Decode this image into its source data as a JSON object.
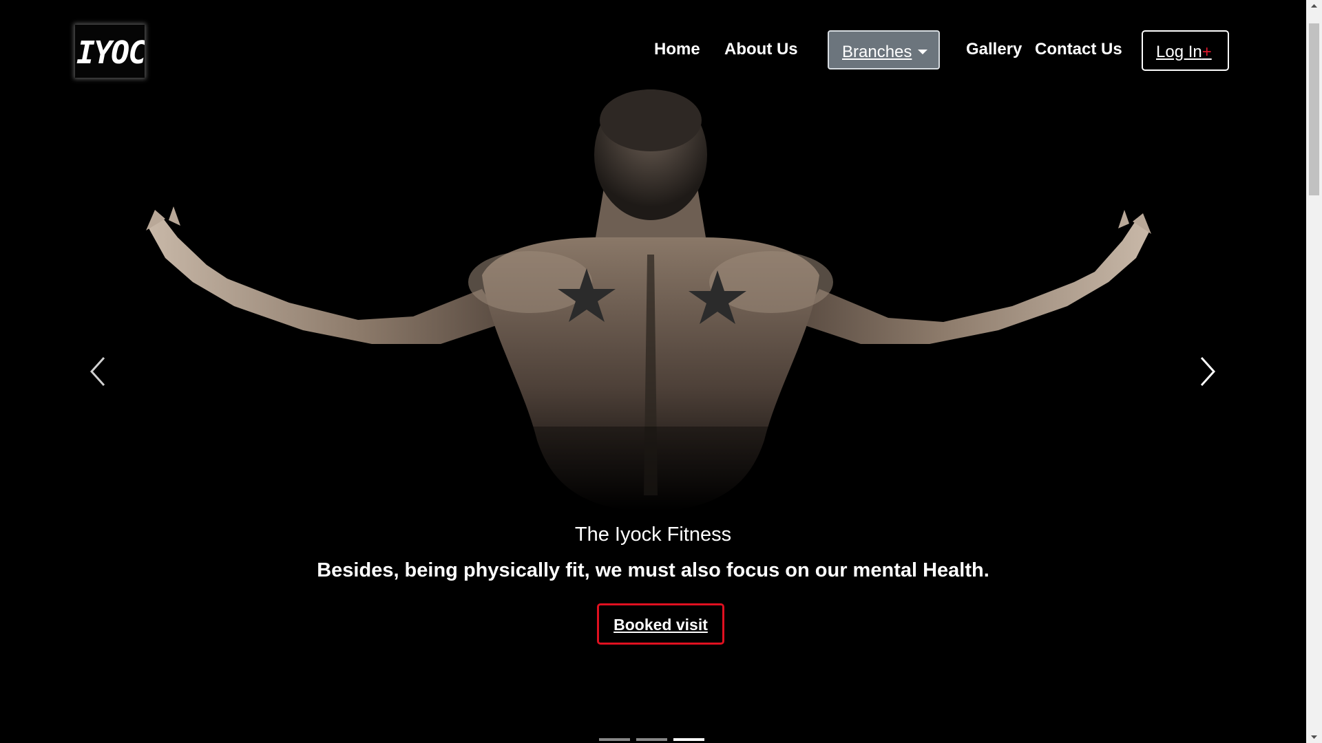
{
  "brand": {
    "logo_text": "IYOC"
  },
  "nav": {
    "home": "Home",
    "about": "About Us",
    "branches": "Branches",
    "gallery": "Gallery",
    "contact": "Contact Us",
    "login": "Log In",
    "login_suffix": "+"
  },
  "hero": {
    "title": "The Iyock Fitness",
    "subtitle": "Besides, being physically fit, we must also focus on our mental Health.",
    "cta": "Booked visit"
  },
  "carousel": {
    "slide_count": 3,
    "active_slide": 3,
    "prev_icon": "chevron-left-icon",
    "next_icon": "chevron-right-icon"
  },
  "colors": {
    "background": "#000000",
    "branches_bg": "#6c757d",
    "accent_red": "#e01020"
  }
}
